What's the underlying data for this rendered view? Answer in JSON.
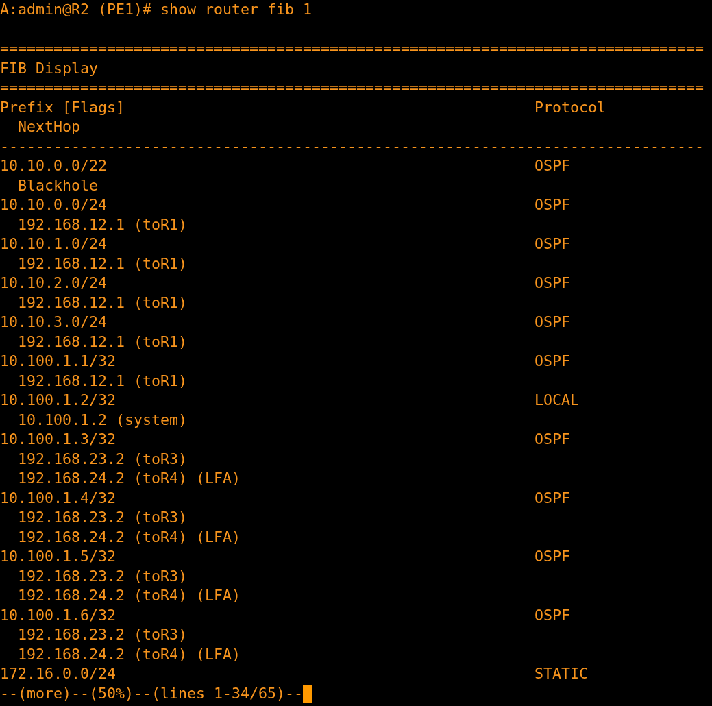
{
  "prompt": "A:admin@R2 (PE1)# show router fib 1",
  "rule_double": "===============================================================================",
  "title": "FIB Display",
  "header": {
    "prefix": "Prefix [Flags]",
    "protocol": "Protocol",
    "next_hop": "NextHop"
  },
  "rule_single": "-------------------------------------------------------------------------------",
  "routes": [
    {
      "prefix": "10.10.0.0/22",
      "protocol": "OSPF",
      "next_hops": [
        "Blackhole"
      ]
    },
    {
      "prefix": "10.10.0.0/24",
      "protocol": "OSPF",
      "next_hops": [
        "192.168.12.1 (toR1)"
      ]
    },
    {
      "prefix": "10.10.1.0/24",
      "protocol": "OSPF",
      "next_hops": [
        "192.168.12.1 (toR1)"
      ]
    },
    {
      "prefix": "10.10.2.0/24",
      "protocol": "OSPF",
      "next_hops": [
        "192.168.12.1 (toR1)"
      ]
    },
    {
      "prefix": "10.10.3.0/24",
      "protocol": "OSPF",
      "next_hops": [
        "192.168.12.1 (toR1)"
      ]
    },
    {
      "prefix": "10.100.1.1/32",
      "protocol": "OSPF",
      "next_hops": [
        "192.168.12.1 (toR1)"
      ]
    },
    {
      "prefix": "10.100.1.2/32",
      "protocol": "LOCAL",
      "next_hops": [
        "10.100.1.2 (system)"
      ]
    },
    {
      "prefix": "10.100.1.3/32",
      "protocol": "OSPF",
      "next_hops": [
        "192.168.23.2 (toR3)",
        "192.168.24.2 (toR4) (LFA)"
      ]
    },
    {
      "prefix": "10.100.1.4/32",
      "protocol": "OSPF",
      "next_hops": [
        "192.168.23.2 (toR3)",
        "192.168.24.2 (toR4) (LFA)"
      ]
    },
    {
      "prefix": "10.100.1.5/32",
      "protocol": "OSPF",
      "next_hops": [
        "192.168.23.2 (toR3)",
        "192.168.24.2 (toR4) (LFA)"
      ]
    },
    {
      "prefix": "10.100.1.6/32",
      "protocol": "OSPF",
      "next_hops": [
        "192.168.23.2 (toR3)",
        "192.168.24.2 (toR4) (LFA)"
      ]
    },
    {
      "prefix": "172.16.0.0/24",
      "protocol": "STATIC"
    }
  ],
  "pager": "--(more)--(50%)--(lines 1-34/65)--"
}
